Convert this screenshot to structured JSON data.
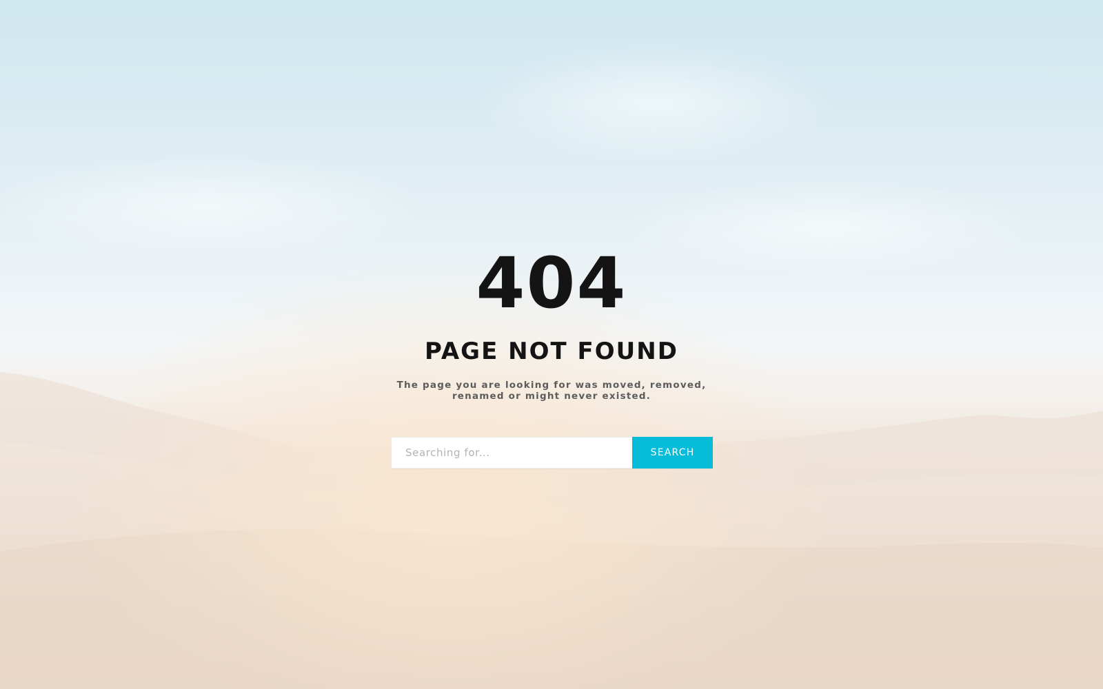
{
  "error": {
    "code": "404",
    "title": "PAGE NOT FOUND",
    "message_line1": "The page you are looking for was moved, removed,",
    "message_line2": "renamed or might never existed."
  },
  "search": {
    "placeholder": "Searching for...",
    "value": "",
    "button_label": "SEARCH"
  },
  "colors": {
    "accent": "#07bcd8",
    "heading": "#141414",
    "message": "#5c5c5c",
    "sky": "#cfe7ef",
    "sand": "#ebdbcd"
  }
}
